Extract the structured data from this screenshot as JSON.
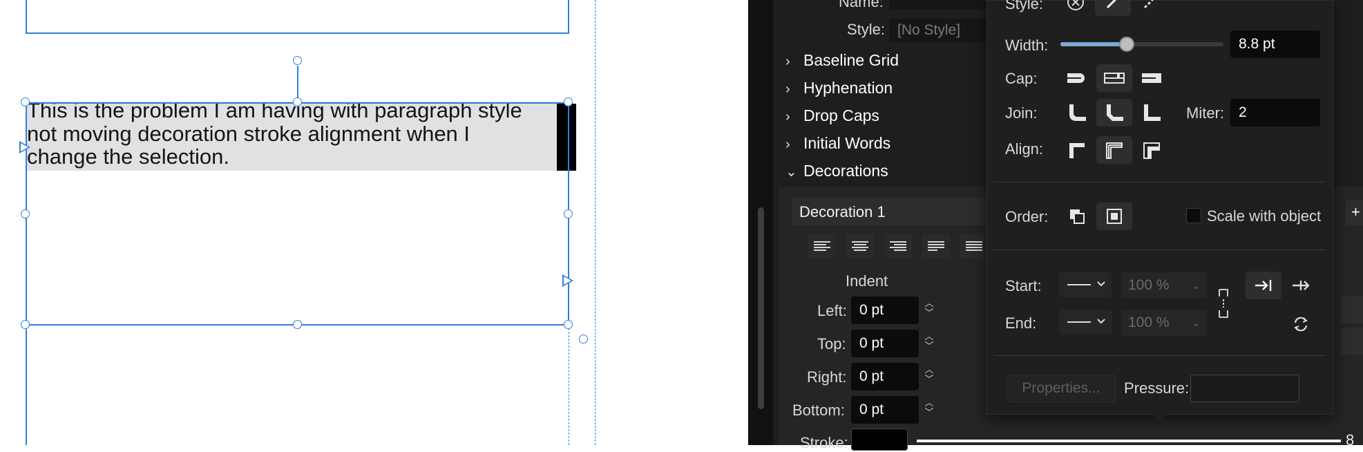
{
  "document": {
    "paragraph_lines": [
      "This is  the problem I am having with paragraph style",
      "not moving decoration stroke alignment when I",
      "change the selection."
    ]
  },
  "panel": {
    "name_label": "Name:",
    "style_label": "Style:",
    "style_value": "[No Style]",
    "sections": [
      {
        "label": "Baseline Grid",
        "expanded": false
      },
      {
        "label": "Hyphenation",
        "expanded": false
      },
      {
        "label": "Drop Caps",
        "expanded": false
      },
      {
        "label": "Initial Words",
        "expanded": false
      },
      {
        "label": "Decorations",
        "expanded": true
      }
    ],
    "decoration_name": "Decoration 1",
    "indent_title": "Indent",
    "indents": [
      {
        "label": "Left:",
        "value": "0 pt"
      },
      {
        "label": "Top:",
        "value": "0 pt"
      },
      {
        "label": "Right:",
        "value": "0 pt"
      },
      {
        "label": "Bottom:",
        "value": "0 pt"
      }
    ],
    "stroke_label": "Stroke:",
    "stroke_value_fragment": "8",
    "add_fragment": "+"
  },
  "popover": {
    "style_label": "Style:",
    "width_label": "Width:",
    "width_value": "8.8 pt",
    "width_slider_fraction": 0.4,
    "cap_label": "Cap:",
    "join_label": "Join:",
    "miter_label": "Miter:",
    "miter_value": "2",
    "align_label": "Align:",
    "order_label": "Order:",
    "scale_label": "Scale with object",
    "start_label": "Start:",
    "end_label": "End:",
    "start_percent": "100 %",
    "end_percent": "100 %",
    "properties_label": "Properties...",
    "pressure_label": "Pressure:"
  },
  "colors": {
    "selection": "#2f7de1",
    "panel_bg": "#1e1e1e",
    "highlight": "#e1e1e4",
    "accent_fill": "#7fa8d6"
  }
}
